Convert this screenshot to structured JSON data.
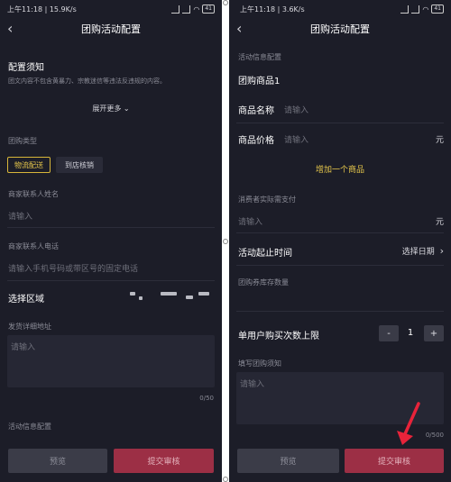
{
  "status": {
    "left": {
      "time_speed": "上午11:18 | 15.9K/s",
      "battery": "41"
    },
    "right": {
      "time_speed": "上午11:18 | 3.6K/s",
      "battery": "41"
    }
  },
  "nav": {
    "title": "团购活动配置",
    "back_glyph": "‹"
  },
  "left": {
    "notice_title": "配置须知",
    "notice_text": "团文内容不包含黄暴力、宗教迷信等违法反违规的内容。",
    "expand_more": "展开更多",
    "expand_glyph": "⌄",
    "group_type_label": "团购类型",
    "tag_logistics": "物流配送",
    "tag_store": "到店核销",
    "contact_name_label": "商家联系人姓名",
    "contact_name_placeholder": "请输入",
    "contact_phone_label": "商家联系人电话",
    "contact_phone_placeholder": "请输入手机号码或带区号的固定电话",
    "region_label": "选择区域",
    "address_label": "发货详细地址",
    "address_placeholder": "请输入",
    "address_counter": "0/50",
    "activity_info_label": "活动信息配置",
    "preview_button": "预览",
    "submit_button": "提交审核"
  },
  "right": {
    "activity_info_label": "活动信息配置",
    "goods_title": "团购商品1",
    "goods_name_label": "商品名称",
    "goods_name_placeholder": "请输入",
    "goods_price_label": "商品价格",
    "goods_price_placeholder": "请输入",
    "price_unit": "元",
    "add_goods": "增加一个商品",
    "actual_pay_label": "消费者实际需支付",
    "actual_pay_placeholder": "请输入",
    "actual_pay_unit": "元",
    "time_label": "活动起止时间",
    "time_value": "选择日期",
    "time_chevron": "›",
    "stock_label": "团购券库存数量",
    "limit_label": "单用户购买次数上限",
    "limit_minus": "-",
    "limit_value": "1",
    "limit_plus": "+",
    "notice_label": "填写团购须知",
    "notice_placeholder": "请输入",
    "notice_counter": "0/500",
    "preview_button": "预览",
    "submit_button": "提交审核"
  },
  "colors": {
    "background": "#1c1d28",
    "accent_yellow": "#e6c74b",
    "submit_red": "#9c2f45",
    "annotation_arrow": "#e8233a"
  }
}
